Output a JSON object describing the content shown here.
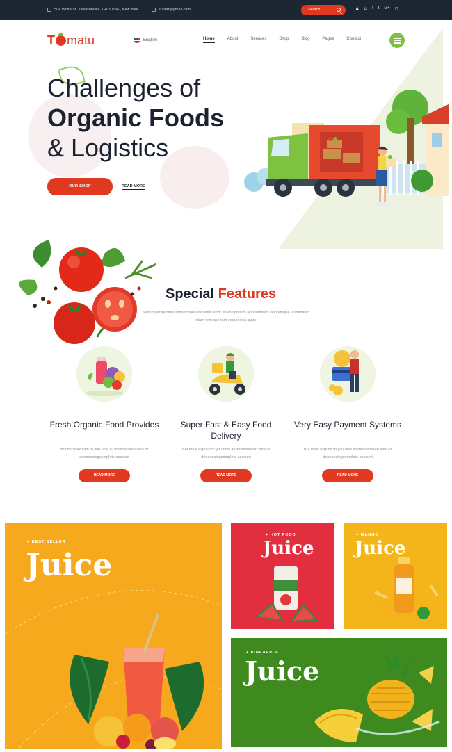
{
  "topbar": {
    "address": "504 White St . Dawsonville, GA 30534 , New York",
    "email": "suport@gmail.com",
    "search_placeholder": "Search",
    "icons": [
      "user-icon",
      "cart-icon",
      "facebook-icon",
      "twitter-icon",
      "google-plus-icon",
      "instagram-icon"
    ],
    "icon_glyphs": [
      "♟",
      "⊔",
      "f",
      "t",
      "G+",
      "◻"
    ]
  },
  "header": {
    "logo_first": "T",
    "logo_rest": "matu",
    "language": "English",
    "nav": [
      "Home",
      "About",
      "Services",
      "Shop",
      "Blog",
      "Pages",
      "Contact"
    ]
  },
  "hero": {
    "title_line1": "Challenges of",
    "title_line2": "Organic Foods",
    "title_line3": "& Logistics",
    "shop_button": "OUR SHOP",
    "read_more": "READ MORE"
  },
  "features": {
    "title_plain": "Special",
    "title_accent": "Features",
    "subtitle": "Sed ut perspiciatis unde omnis iste natus error sit voluptatem accusantium doloremque laudantium totam rem aperiam eaque ipsa quae.",
    "items": [
      {
        "title": "Fresh Organic Food Provides",
        "desc": "But must explain to you how all thismistaken idea of denouncingcomplete account",
        "button": "READ MORE"
      },
      {
        "title": "Super Fast & Easy Food Delivery",
        "desc": "But must explain to you how all thismistaken idea of denouncingcomplete account",
        "button": "READ MORE"
      },
      {
        "title": "Very Easy Payment Systems",
        "desc": "But must explain to you how all thismistaken idea of denouncingcomplete account",
        "button": "READ MORE"
      }
    ]
  },
  "promos": [
    {
      "tag": "+ BEST SELLER",
      "title": "Juice"
    },
    {
      "tag": "+ HOT FOOD",
      "title": "Juice"
    },
    {
      "tag": "+ MANGO",
      "title": "Juice"
    },
    {
      "tag": "+ PINEAPPLE",
      "title": "Juice"
    }
  ],
  "colors": {
    "accent_red": "#e0391f",
    "brand_green": "#7fc241",
    "topbar_bg": "#1c2733"
  }
}
